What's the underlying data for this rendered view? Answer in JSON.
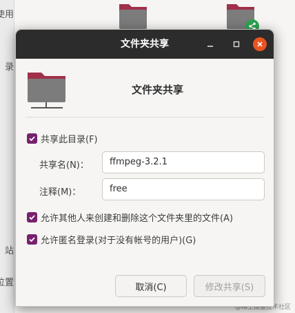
{
  "background": {
    "sidebar_texts": [
      "使用",
      "录",
      "站",
      "位置"
    ],
    "watermark": "@稀土掘金技术社区"
  },
  "dialog": {
    "title": "文件夹共享",
    "heading": "文件夹共享",
    "share_checkbox": {
      "label": "共享此目录(F)",
      "checked": true
    },
    "share_name": {
      "label": "共享名(N)：",
      "value": "ffmpeg-3.2.1"
    },
    "comment": {
      "label": "注释(M)：",
      "value": "free"
    },
    "allow_others": {
      "label": "允许其他人来创建和删除这个文件夹里的文件(A)",
      "checked": true
    },
    "guest_access": {
      "label": "允许匿名登录(对于没有帐号的用户)(G)",
      "checked": true
    },
    "buttons": {
      "cancel": "取消(C)",
      "modify": "修改共享(S)"
    }
  },
  "colors": {
    "titlebar": "#2c2c2c",
    "close_button": "#e95420",
    "checkbox": "#77216f",
    "folder_top": "#a1304a",
    "folder_body": "#7c7c7c",
    "share_emblem": "#2ea44f"
  }
}
